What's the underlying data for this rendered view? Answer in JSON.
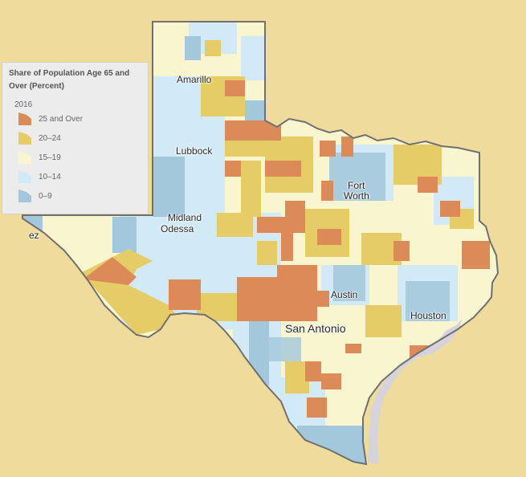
{
  "legend": {
    "title": "Share of Population Age 65 and Over (Percent)",
    "year": "2016",
    "classes": [
      {
        "label": "25 and Over",
        "color": "#dc8a58"
      },
      {
        "label": "20–24",
        "color": "#e6cc66"
      },
      {
        "label": "15–19",
        "color": "#f8f5cf"
      },
      {
        "label": "10–14",
        "color": "#d2eaf7"
      },
      {
        "label": "0–9",
        "color": "#a3c7db"
      }
    ]
  },
  "cities": {
    "amarillo": "Amarillo",
    "lubbock": "Lubbock",
    "midland": "Midland",
    "odessa": "Odessa",
    "fort": "Fort",
    "worth": "Worth",
    "austin": "Austin",
    "san_antonio": "San Antonio",
    "houston": "Houston",
    "juarez_partial": "ez"
  },
  "colors": {
    "background": "#efdb9b",
    "border": "#707070",
    "water": "#d6d3dc"
  }
}
